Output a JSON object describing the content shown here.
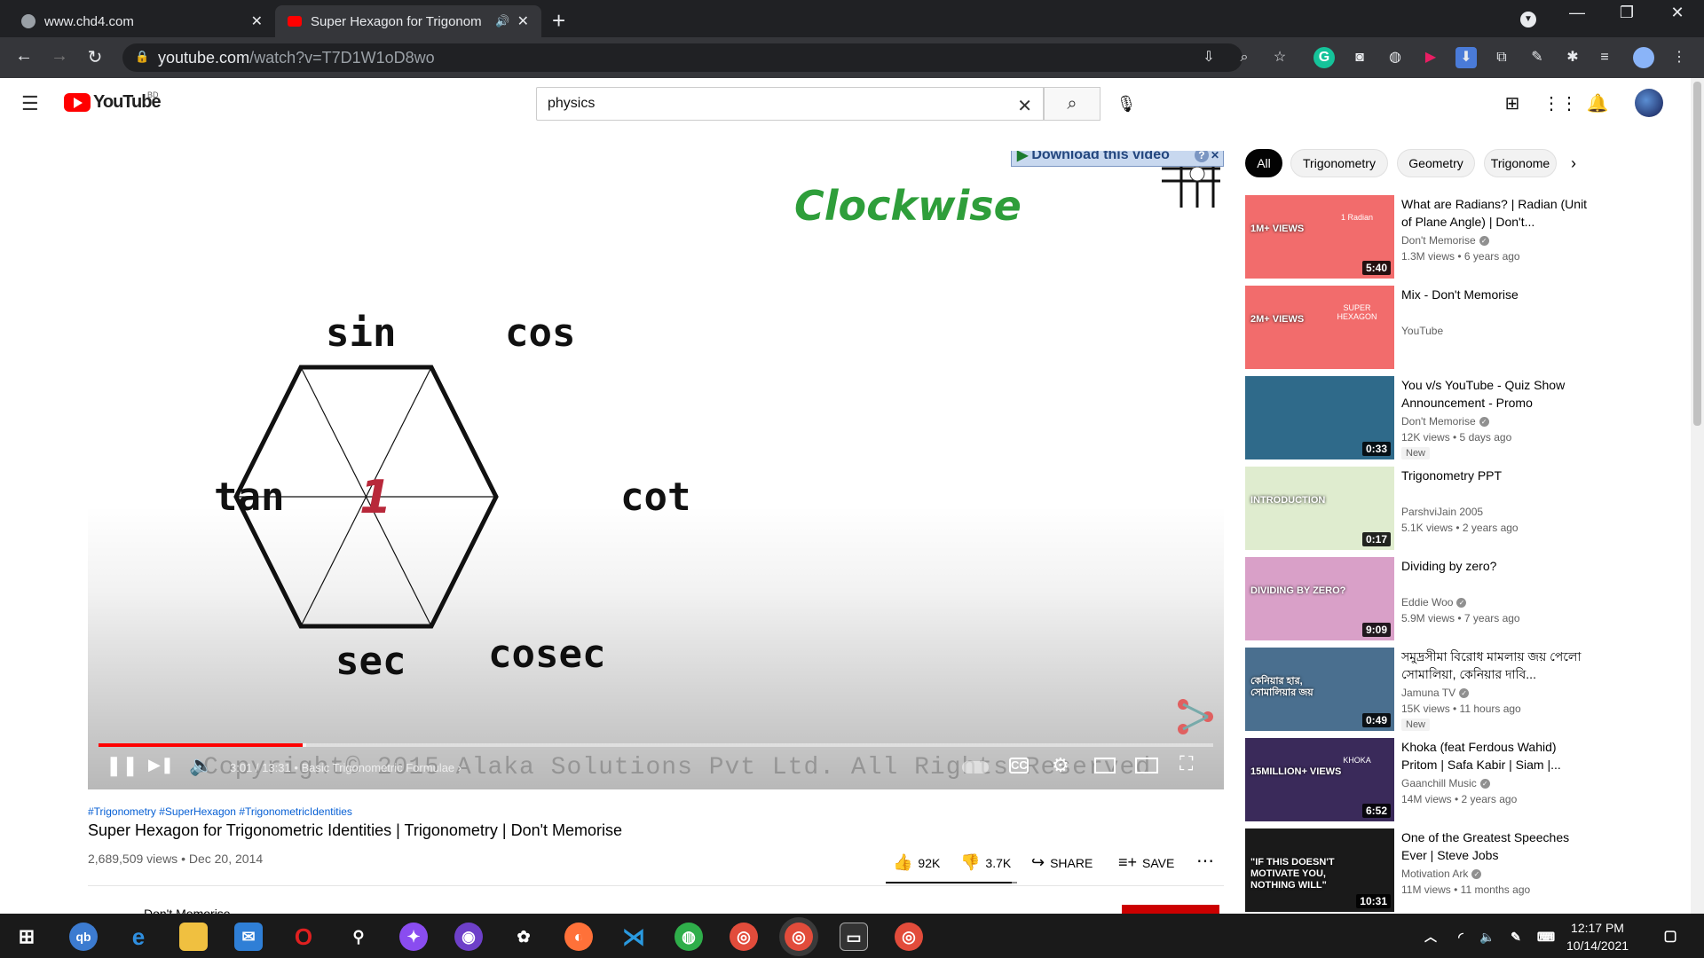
{
  "browser": {
    "tabs": [
      {
        "title": "www.chd4.com"
      },
      {
        "title": "Super Hexagon for Trigonom"
      }
    ],
    "url_host": "youtube.com",
    "url_path": "/watch?v=T7D1W1oD8wo"
  },
  "youtube": {
    "logo_text": "YouTube",
    "country": "BD",
    "search_value": "physics"
  },
  "video": {
    "drawing": {
      "heading": "Clockwise",
      "center": "1",
      "labels": {
        "sin": "sin",
        "cos": "cos",
        "tan": "tan",
        "cot": "cot",
        "sec": "sec",
        "cosec": "cosec"
      }
    },
    "download_banner": "Download this video",
    "watermark": "Copyright© 2015 Alaka Solutions Pvt Ltd. All Rights Reserved",
    "time_current": "3:01",
    "time_total": "13:31",
    "chapter": "Basic Trigonometric Formulae",
    "progress": 0.183,
    "buffered": 0.186,
    "hashtags": "#Trigonometry #SuperHexagon #TrigonometricIdentities",
    "title": "Super Hexagon for Trigonometric Identities | Trigonometry | Don't Memorise",
    "meta": "2,689,509 views • Dec 20, 2014",
    "likes": "92K",
    "dislikes": "3.7K",
    "share": "SHARE",
    "save": "SAVE",
    "like_ratio": 0.96,
    "channel": "Don't Memorise"
  },
  "chips": [
    "All",
    "Trigonometry",
    "Geometry",
    "Trigonome"
  ],
  "recommendations": [
    {
      "title": "What are Radians? | Radian (Unit of Plane Angle) | Don't...",
      "channel": "Don't Memorise",
      "verified": true,
      "meta": "1.3M views • 6 years ago",
      "duration": "5:40",
      "badge": "",
      "thumb_text": "1M+ VIEWS",
      "thumb_sub": "1 Radian",
      "color": "#f26c6c"
    },
    {
      "title": "Mix - Don't Memorise",
      "channel": "YouTube",
      "verified": false,
      "meta": "",
      "duration": "",
      "badge": "",
      "thumb_text": "2M+ VIEWS",
      "thumb_sub": "SUPER HEXAGON",
      "color": "#f26c6c"
    },
    {
      "title": "You v/s YouTube - Quiz Show Announcement - Promo",
      "channel": "Don't Memorise",
      "verified": true,
      "meta": "12K views • 5 days ago",
      "duration": "0:33",
      "badge": "New",
      "thumb_text": "",
      "thumb_sub": "",
      "color": "#2f6a8a"
    },
    {
      "title": "Trigonometry PPT",
      "channel": "ParshviJain 2005",
      "verified": false,
      "meta": "5.1K views • 2 years ago",
      "duration": "0:17",
      "badge": "",
      "thumb_text": "INTRODUCTION",
      "thumb_sub": "",
      "color": "#dfeccf"
    },
    {
      "title": "Dividing by zero?",
      "channel": "Eddie Woo",
      "verified": true,
      "meta": "5.9M views • 7 years ago",
      "duration": "9:09",
      "badge": "",
      "thumb_text": "DIVIDING BY ZERO?",
      "thumb_sub": "",
      "color": "#d9a0c8"
    },
    {
      "title": "সমুদ্রসীমা বিরোধ মামলায় জয় পেলো সোমালিয়া, কেনিয়ার দাবি...",
      "channel": "Jamuna TV",
      "verified": true,
      "meta": "15K views • 11 hours ago",
      "duration": "0:49",
      "badge": "New",
      "thumb_text": "কেনিয়ার হার, সোমালিয়ার জয়",
      "thumb_sub": "",
      "color": "#4a6f8f"
    },
    {
      "title": "Khoka (feat Ferdous Wahid) Pritom | Safa Kabir | Siam |...",
      "channel": "Gaanchill Music",
      "verified": true,
      "meta": "14M views • 2 years ago",
      "duration": "6:52",
      "badge": "",
      "thumb_text": "15MILLION+ VIEWS",
      "thumb_sub": "KHOKA",
      "color": "#3a2a5a"
    },
    {
      "title": "One of the Greatest Speeches Ever | Steve Jobs",
      "channel": "Motivation Ark",
      "verified": true,
      "meta": "11M views • 11 months ago",
      "duration": "10:31",
      "badge": "",
      "thumb_text": "\"IF THIS DOESN'T MOTIVATE YOU, NOTHING WILL\"",
      "thumb_sub": "",
      "color": "#1a1a1a"
    }
  ],
  "taskbar": {
    "time": "12:17 PM",
    "date": "10/14/2021"
  },
  "icons": {
    "back": "arrow-left-icon",
    "forward": "arrow-right-icon",
    "reload": "reload-icon",
    "search": "search-icon",
    "mic": "microphone-icon",
    "notifications": "bell-icon"
  }
}
